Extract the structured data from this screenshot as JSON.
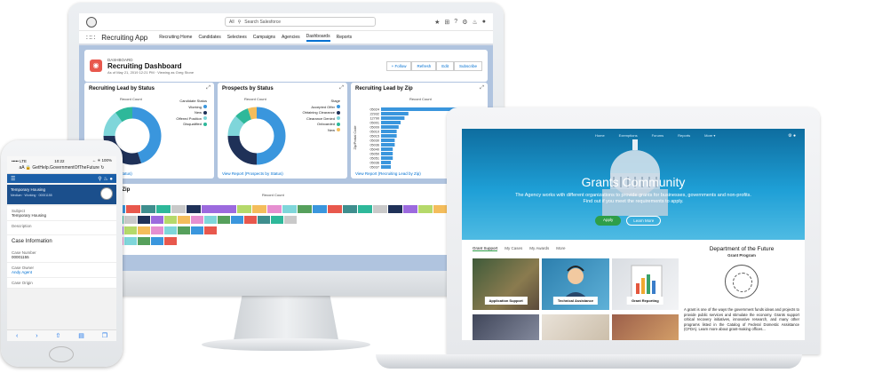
{
  "desktop": {
    "search_placeholder": "Search Salesforce",
    "search_scope": "All",
    "app_name": "Recruiting App",
    "nav_items": [
      "Recruiting Home",
      "Candidates",
      "Selectees",
      "Campaigns",
      "Agencies",
      "Dashboards",
      "Reports"
    ],
    "dashboard_label": "DASHBOARD",
    "dashboard_title": "Recruiting Dashboard",
    "dashboard_meta": "As of May 21, 2019 12:21 PM · Viewing as Greg Stone",
    "buttons": [
      "+ Follow",
      "Refresh",
      "Edit",
      "Subscribe"
    ],
    "cards": [
      {
        "title": "Recruiting Lead by Status",
        "axis": "Record Count",
        "legend_title": "Candidate Status",
        "legend": [
          "Working",
          "New",
          "Offered Position",
          "Disqualified"
        ],
        "colors": [
          "#3a96dd",
          "#1f3158",
          "#7fd6da",
          "#2eb89a"
        ],
        "values": [
          45,
          30,
          15,
          10
        ],
        "link": "...ruiting Lead by Status)"
      },
      {
        "title": "Prospects by Status",
        "axis": "Record Count",
        "legend_title": "Stage",
        "legend": [
          "Accepted Offer",
          "Obtaining Clearance",
          "Clearance Denied",
          "Onboarded",
          "New"
        ],
        "colors": [
          "#3a96dd",
          "#1f3158",
          "#7fd6da",
          "#2eb89a",
          "#f4bd5b"
        ],
        "values": [
          50,
          25,
          12,
          8,
          5
        ],
        "link": "View Report (Prospects by Status)"
      },
      {
        "title": "Recruiting Lead by Zip",
        "axis": "Record Count",
        "ylabel": "Zip/Postal Code",
        "zips": [
          "05024",
          "22932",
          "12790",
          "05001",
          "05009",
          "05010",
          "05015",
          "05030",
          "05036",
          "05040",
          "05050",
          "05051",
          "05036",
          "05037"
        ],
        "values": [
          48,
          14,
          12,
          10,
          9,
          8,
          8,
          7,
          7,
          6,
          6,
          6,
          5,
          5
        ],
        "link": "View Report (Recruiting Lead by Zip)"
      }
    ],
    "wide_card": {
      "title": "...Status and Zip",
      "axis": "Record Count",
      "rows": [
        "...pted Offer",
        "...rance",
        "...Denied",
        "...oarded"
      ],
      "side_label": "Billing"
    }
  },
  "phone": {
    "carrier": "••••• LTE",
    "time": "10:22",
    "battery": "← ✳ 100%",
    "url": "GetHelp.GovernmentOfTheFuture",
    "record_title": "Temporary Housing",
    "record_meta": "Medium · Working · 00001155",
    "subject_label": "Subject",
    "subject_value": "Temporary Housing",
    "description_label": "Description",
    "case_info": "Case Information",
    "case_number_label": "Case Number",
    "case_number": "00001155",
    "case_owner_label": "Case Owner",
    "case_owner": "Andy Agent",
    "case_origin_label": "Case Origin"
  },
  "laptop": {
    "nav": [
      "Home",
      "Exemptions",
      "",
      "Forums",
      "Reports",
      "More ▾"
    ],
    "hero_title": "Grants Community",
    "hero_text": "The Agency works with different organizations to provide grants for businesses, governments and non-profits. Find out if you meet the requirements to apply.",
    "apply": "Apply",
    "learn_more": "Learn More",
    "tabs": [
      "Grant Support",
      "My Cases",
      "My Awards",
      "More"
    ],
    "tiles": [
      "Application Support",
      "Technical Assistance",
      "Grant Reporting"
    ],
    "side_title": "Department of the Future",
    "side_sub": "Grant Program",
    "side_text": "A grant is one of the ways the government funds ideas and projects to provide public services and stimulate the economy. Grants support critical recovery initiatives, innovative research, and many other programs listed in the Catalog of Federal Domestic Assistance (CFDA). Learn more about grant-making offices..."
  }
}
